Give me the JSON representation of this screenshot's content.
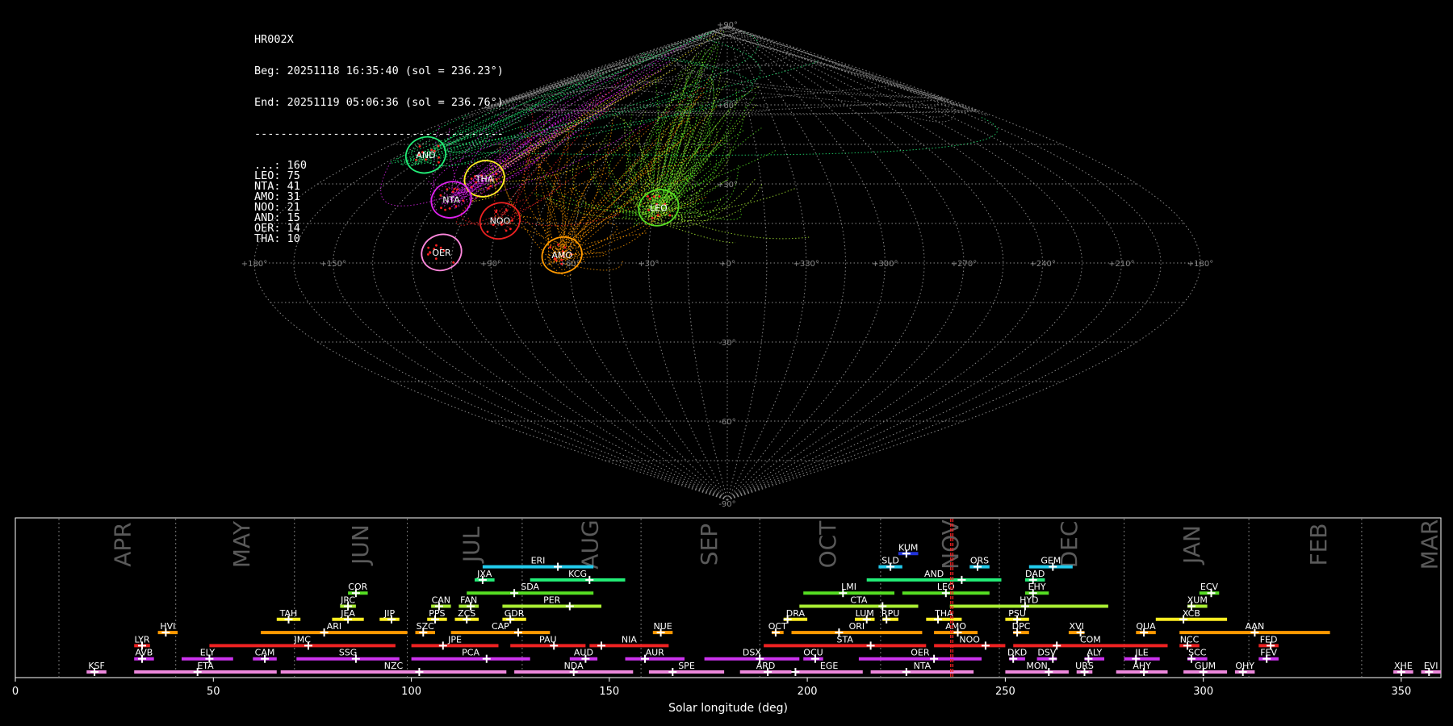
{
  "info": {
    "title": "HR002X",
    "beg": "Beg: 20251118 16:35:40 (sol = 236.23°)",
    "end": "End: 20251119 05:06:36 (sol = 236.76°)",
    "separator": "--------------------------------------",
    "counts": [
      {
        "code": "...",
        "n": 160
      },
      {
        "code": "LEO",
        "n": 75
      },
      {
        "code": "NTA",
        "n": 41
      },
      {
        "code": "AMO",
        "n": 31
      },
      {
        "code": "NOO",
        "n": 21
      },
      {
        "code": "AND",
        "n": 15
      },
      {
        "code": "OER",
        "n": 14
      },
      {
        "code": "THA",
        "n": 10
      }
    ]
  },
  "chart_data": [
    {
      "type": "scatter",
      "projection": "sinusoidal",
      "grid": true,
      "lon_ticks": [
        "+180°",
        "+150°",
        "+90°",
        "+60°",
        "+30°",
        "+0°",
        "+330°",
        "+300°",
        "+270°",
        "+240°",
        "+210°",
        "+180°"
      ],
      "lat_ticks": [
        "+90°",
        "+60°",
        "+30°",
        "-30°",
        "-60°",
        "-90°"
      ],
      "showers": [
        {
          "code": "LEO",
          "lon": 152,
          "lat": 21,
          "color": "#55dd22"
        },
        {
          "code": "THA",
          "lon": 71,
          "lat": 32,
          "color": "#ffee22"
        },
        {
          "code": "AND",
          "lon": 28,
          "lat": 41,
          "color": "#22ee77"
        },
        {
          "code": "NTA",
          "lon": 65,
          "lat": 24,
          "color": "#dd22ee"
        },
        {
          "code": "NOO",
          "lon": 90,
          "lat": 16,
          "color": "#ee2222"
        },
        {
          "code": "AMO",
          "lon": 117,
          "lat": 3,
          "color": "#ff9900"
        },
        {
          "code": "OER",
          "lon": 71,
          "lat": 4,
          "color": "#ff88dd"
        }
      ]
    },
    {
      "type": "bar",
      "xlabel": "Solar longitude (deg)",
      "xlim": [
        0,
        360
      ],
      "xticks": [
        0,
        50,
        100,
        150,
        200,
        250,
        300,
        350
      ],
      "current_sol": [
        236.23,
        236.76
      ],
      "months": [
        {
          "label": "APR",
          "pos": 24,
          "bound": 11
        },
        {
          "label": "MAY",
          "pos": 54,
          "bound": 40.5
        },
        {
          "label": "JUN",
          "pos": 84,
          "bound": 70.5
        },
        {
          "label": "JUL",
          "pos": 112,
          "bound": 99
        },
        {
          "label": "AUG",
          "pos": 142,
          "bound": 128
        },
        {
          "label": "SEP",
          "pos": 172,
          "bound": 158
        },
        {
          "label": "OCT",
          "pos": 202,
          "bound": 188
        },
        {
          "label": "NOV",
          "pos": 233,
          "bound": 218.5
        },
        {
          "label": "DEC",
          "pos": 263,
          "bound": 248.5
        },
        {
          "label": "JAN",
          "pos": 294,
          "bound": 280
        },
        {
          "label": "FEB",
          "pos": 326,
          "bound": 311.5
        },
        {
          "label": "MAR",
          "pos": 354,
          "bound": 340
        }
      ],
      "showers": [
        {
          "code": "KSF",
          "row": 0,
          "start": 18,
          "end": 23,
          "peak": 20,
          "color": "#ee88dd"
        },
        {
          "code": "ETA",
          "row": 0,
          "start": 30,
          "end": 66,
          "peak": 46,
          "color": "#ee88dd"
        },
        {
          "code": "NZC",
          "row": 0,
          "start": 67,
          "end": 124,
          "peak": 102,
          "color": "#ee88dd"
        },
        {
          "code": "NDA",
          "row": 0,
          "start": 126,
          "end": 156,
          "peak": 141,
          "color": "#ee88dd"
        },
        {
          "code": "SPE",
          "row": 0,
          "start": 160,
          "end": 179,
          "peak": 166,
          "color": "#ee88dd"
        },
        {
          "code": "ARD",
          "row": 0,
          "start": 183,
          "end": 196,
          "peak": 190,
          "color": "#ee88dd"
        },
        {
          "code": "EGE",
          "row": 0,
          "start": 197,
          "end": 214,
          "peak": 197,
          "color": "#ee88dd"
        },
        {
          "code": "NTA",
          "row": 0,
          "start": 216,
          "end": 242,
          "peak": 225,
          "color": "#ee88dd"
        },
        {
          "code": "MON",
          "row": 0,
          "start": 250,
          "end": 266,
          "peak": 261,
          "color": "#ee88dd"
        },
        {
          "code": "URS",
          "row": 0,
          "start": 268,
          "end": 272,
          "peak": 270,
          "color": "#ee88dd"
        },
        {
          "code": "AHY",
          "row": 0,
          "start": 278,
          "end": 291,
          "peak": 285,
          "color": "#ee88dd"
        },
        {
          "code": "GUM",
          "row": 0,
          "start": 295,
          "end": 306,
          "peak": 300,
          "color": "#ee88dd"
        },
        {
          "code": "OHY",
          "row": 0,
          "start": 308,
          "end": 313,
          "peak": 310,
          "color": "#ee88dd"
        },
        {
          "code": "XHE",
          "row": 0,
          "start": 348,
          "end": 353,
          "peak": 350,
          "color": "#ee88dd"
        },
        {
          "code": "EVI",
          "row": 0,
          "start": 355,
          "end": 360,
          "peak": 357,
          "color": "#ee88dd"
        },
        {
          "code": "AVB",
          "row": 1,
          "start": 30,
          "end": 35,
          "peak": 32,
          "color": "#cc33ee"
        },
        {
          "code": "ELY",
          "row": 1,
          "start": 42,
          "end": 55,
          "peak": 49,
          "color": "#cc33ee"
        },
        {
          "code": "CAM",
          "row": 1,
          "start": 60,
          "end": 66,
          "peak": 63,
          "color": "#cc33ee"
        },
        {
          "code": "SSG",
          "row": 1,
          "start": 71,
          "end": 97,
          "peak": 86,
          "color": "#cc33ee"
        },
        {
          "code": "PCA",
          "row": 1,
          "start": 100,
          "end": 130,
          "peak": 119,
          "color": "#cc33ee"
        },
        {
          "code": "AUD",
          "row": 1,
          "start": 140,
          "end": 147,
          "peak": 144,
          "color": "#cc33ee"
        },
        {
          "code": "AUR",
          "row": 1,
          "start": 154,
          "end": 169,
          "peak": 159,
          "color": "#cc33ee"
        },
        {
          "code": "DSX",
          "row": 1,
          "start": 174,
          "end": 198,
          "peak": 188,
          "color": "#cc33ee"
        },
        {
          "code": "OCU",
          "row": 1,
          "start": 199,
          "end": 204,
          "peak": 202,
          "color": "#cc33ee"
        },
        {
          "code": "OER",
          "row": 1,
          "start": 213,
          "end": 244,
          "peak": 232,
          "color": "#cc33ee"
        },
        {
          "code": "DKD",
          "row": 1,
          "start": 251,
          "end": 255,
          "peak": 252,
          "color": "#cc33ee"
        },
        {
          "code": "DSV",
          "row": 1,
          "start": 258,
          "end": 263,
          "peak": 262,
          "color": "#cc33ee"
        },
        {
          "code": "ALY",
          "row": 1,
          "start": 270,
          "end": 275,
          "peak": 271,
          "color": "#cc33ee"
        },
        {
          "code": "JLE",
          "row": 1,
          "start": 280,
          "end": 289,
          "peak": 283,
          "color": "#cc33ee"
        },
        {
          "code": "SCC",
          "row": 1,
          "start": 296,
          "end": 301,
          "peak": 297,
          "color": "#cc33ee"
        },
        {
          "code": "FEV",
          "row": 1,
          "start": 314,
          "end": 319,
          "peak": 316,
          "color": "#cc33ee"
        },
        {
          "code": "LYR",
          "row": 2,
          "start": 30,
          "end": 34,
          "peak": 32,
          "color": "#ee2222"
        },
        {
          "code": "JMC",
          "row": 2,
          "start": 49,
          "end": 96,
          "peak": 74,
          "color": "#ee2222"
        },
        {
          "code": "JPE",
          "row": 2,
          "start": 100,
          "end": 122,
          "peak": 108,
          "color": "#ee2222"
        },
        {
          "code": "PAU",
          "row": 2,
          "start": 125,
          "end": 144,
          "peak": 136,
          "color": "#ee2222"
        },
        {
          "code": "NIA",
          "row": 2,
          "start": 145,
          "end": 165,
          "peak": 148,
          "color": "#ee2222"
        },
        {
          "code": "STA",
          "row": 2,
          "start": 189,
          "end": 230,
          "peak": 216,
          "color": "#ee2222"
        },
        {
          "code": "NOO",
          "row": 2,
          "start": 232,
          "end": 250,
          "peak": 245,
          "color": "#ee2222"
        },
        {
          "code": "COM",
          "row": 2,
          "start": 252,
          "end": 291,
          "peak": 263,
          "color": "#ee2222"
        },
        {
          "code": "NCC",
          "row": 2,
          "start": 294,
          "end": 299,
          "peak": 296,
          "color": "#ee2222"
        },
        {
          "code": "FED",
          "row": 2,
          "start": 314,
          "end": 319,
          "peak": 317,
          "color": "#ee2222"
        },
        {
          "code": "HVI",
          "row": 3,
          "start": 36,
          "end": 41,
          "peak": 38,
          "color": "#ff9900"
        },
        {
          "code": "ARI",
          "row": 3,
          "start": 62,
          "end": 99,
          "peak": 78,
          "color": "#ff9900"
        },
        {
          "code": "SZC",
          "row": 3,
          "start": 101,
          "end": 106,
          "peak": 103,
          "color": "#ff9900"
        },
        {
          "code": "CAP",
          "row": 3,
          "start": 110,
          "end": 135,
          "peak": 127,
          "color": "#ff9900"
        },
        {
          "code": "NUE",
          "row": 3,
          "start": 161,
          "end": 166,
          "peak": 163,
          "color": "#ff9900"
        },
        {
          "code": "OCT",
          "row": 3,
          "start": 191,
          "end": 194,
          "peak": 192,
          "color": "#ff9900"
        },
        {
          "code": "ORI",
          "row": 3,
          "start": 196,
          "end": 229,
          "peak": 208,
          "color": "#ff9900"
        },
        {
          "code": "AMO",
          "row": 3,
          "start": 232,
          "end": 243,
          "peak": 238,
          "color": "#ff9900"
        },
        {
          "code": "DPC",
          "row": 3,
          "start": 252,
          "end": 256,
          "peak": 253,
          "color": "#ff9900"
        },
        {
          "code": "XVI",
          "row": 3,
          "start": 266,
          "end": 270,
          "peak": 269,
          "color": "#ff9900"
        },
        {
          "code": "QUA",
          "row": 3,
          "start": 283,
          "end": 288,
          "peak": 285,
          "color": "#ff9900"
        },
        {
          "code": "AAN",
          "row": 3,
          "start": 294,
          "end": 332,
          "peak": 313,
          "color": "#ff9900"
        },
        {
          "code": "TAH",
          "row": 4,
          "start": 66,
          "end": 72,
          "peak": 69,
          "color": "#ffee22"
        },
        {
          "code": "JEA",
          "row": 4,
          "start": 80,
          "end": 88,
          "peak": 84,
          "color": "#ffee22"
        },
        {
          "code": "JIP",
          "row": 4,
          "start": 92,
          "end": 97,
          "peak": 95,
          "color": "#ffee22"
        },
        {
          "code": "PPS",
          "row": 4,
          "start": 104,
          "end": 109,
          "peak": 106,
          "color": "#ffee22"
        },
        {
          "code": "ZCS",
          "row": 4,
          "start": 111,
          "end": 117,
          "peak": 114,
          "color": "#ffee22"
        },
        {
          "code": "GDR",
          "row": 4,
          "start": 123,
          "end": 129,
          "peak": 125,
          "color": "#ffee22"
        },
        {
          "code": "DRA",
          "row": 4,
          "start": 194,
          "end": 200,
          "peak": 195,
          "color": "#ffee22"
        },
        {
          "code": "LUM",
          "row": 4,
          "start": 212,
          "end": 217,
          "peak": 215,
          "color": "#ffee22"
        },
        {
          "code": "RPU",
          "row": 4,
          "start": 219,
          "end": 223,
          "peak": 220,
          "color": "#ffee22"
        },
        {
          "code": "THA",
          "row": 4,
          "start": 230,
          "end": 239,
          "peak": 233,
          "color": "#ffee22"
        },
        {
          "code": "PSU",
          "row": 4,
          "start": 250,
          "end": 256,
          "peak": 253,
          "color": "#ffee22"
        },
        {
          "code": "XCB",
          "row": 4,
          "start": 288,
          "end": 306,
          "peak": 295,
          "color": "#ffee22"
        },
        {
          "code": "JRC",
          "row": 5,
          "start": 82,
          "end": 86,
          "peak": 84,
          "color": "#aaee33"
        },
        {
          "code": "CAN",
          "row": 5,
          "start": 105,
          "end": 110,
          "peak": 107,
          "color": "#aaee33"
        },
        {
          "code": "FAN",
          "row": 5,
          "start": 112,
          "end": 117,
          "peak": 115,
          "color": "#aaee33"
        },
        {
          "code": "PER",
          "row": 5,
          "start": 123,
          "end": 148,
          "peak": 140,
          "color": "#aaee33"
        },
        {
          "code": "CTA",
          "row": 5,
          "start": 198,
          "end": 228,
          "peak": 219,
          "color": "#aaee33"
        },
        {
          "code": "HYD",
          "row": 5,
          "start": 236,
          "end": 276,
          "peak": 255,
          "color": "#aaee33"
        },
        {
          "code": "XUM",
          "row": 5,
          "start": 296,
          "end": 301,
          "peak": 297,
          "color": "#aaee33"
        },
        {
          "code": "COR",
          "row": 6,
          "start": 84,
          "end": 89,
          "peak": 86,
          "color": "#55dd22"
        },
        {
          "code": "SDA",
          "row": 6,
          "start": 114,
          "end": 146,
          "peak": 126,
          "color": "#55dd22"
        },
        {
          "code": "LMI",
          "row": 6,
          "start": 199,
          "end": 222,
          "peak": 209,
          "color": "#55dd22"
        },
        {
          "code": "LEO",
          "row": 6,
          "start": 224,
          "end": 246,
          "peak": 235,
          "color": "#55dd22"
        },
        {
          "code": "EHY",
          "row": 6,
          "start": 255,
          "end": 261,
          "peak": 257,
          "color": "#55dd22"
        },
        {
          "code": "ECV",
          "row": 6,
          "start": 299,
          "end": 304,
          "peak": 302,
          "color": "#55dd22"
        },
        {
          "code": "JXA",
          "row": 7,
          "start": 116,
          "end": 121,
          "peak": 118,
          "color": "#22ee77"
        },
        {
          "code": "KCG",
          "row": 7,
          "start": 130,
          "end": 154,
          "peak": 145,
          "color": "#22ee77"
        },
        {
          "code": "AND",
          "row": 7,
          "start": 215,
          "end": 249,
          "peak": 239,
          "color": "#22ee77"
        },
        {
          "code": "DAD",
          "row": 7,
          "start": 255,
          "end": 260,
          "peak": 257,
          "color": "#22ee77"
        },
        {
          "code": "ERI",
          "row": 8,
          "start": 118,
          "end": 146,
          "peak": 137,
          "color": "#22ccee"
        },
        {
          "code": "SLD",
          "row": 8,
          "start": 218,
          "end": 224,
          "peak": 221,
          "color": "#22ccee"
        },
        {
          "code": "ORS",
          "row": 8,
          "start": 241,
          "end": 246,
          "peak": 243,
          "color": "#22ccee"
        },
        {
          "code": "GEM",
          "row": 8,
          "start": 256,
          "end": 267,
          "peak": 262,
          "color": "#22ccee"
        },
        {
          "code": "KUM",
          "row": 9,
          "start": 223,
          "end": 228,
          "peak": 225,
          "color": "#2233dd"
        }
      ]
    }
  ]
}
